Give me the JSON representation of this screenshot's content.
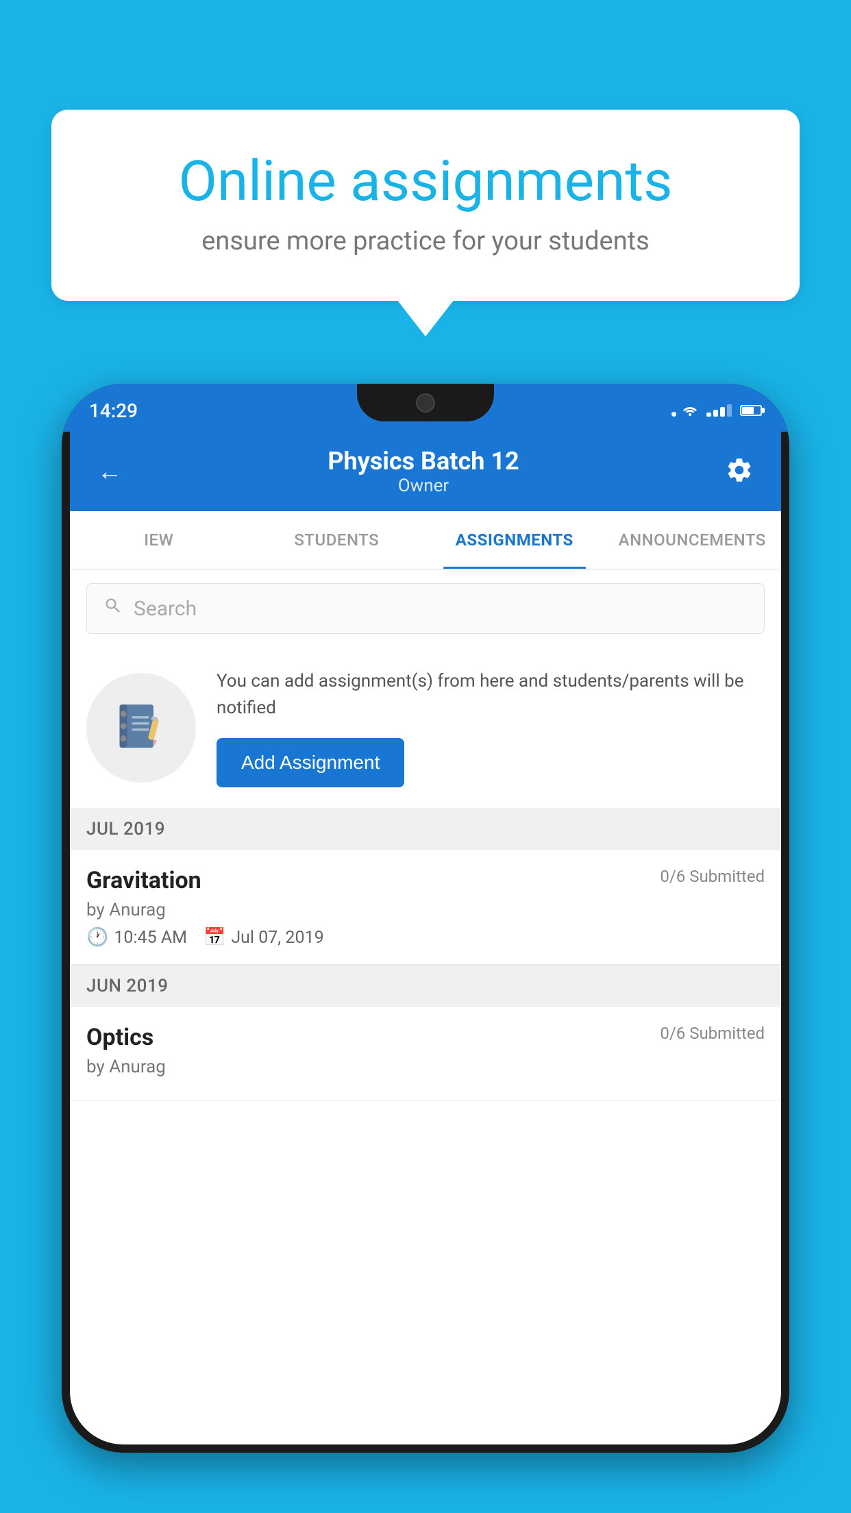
{
  "background_color": "#1ab3e8",
  "speech_bubble": {
    "title": "Online assignments",
    "subtitle": "ensure more practice for your students"
  },
  "phone": {
    "status_bar": {
      "time": "14:29"
    },
    "header": {
      "title": "Physics Batch 12",
      "subtitle": "Owner",
      "back_label": "←",
      "settings_label": "⚙"
    },
    "tabs": [
      {
        "label": "IEW",
        "active": false
      },
      {
        "label": "STUDENTS",
        "active": false
      },
      {
        "label": "ASSIGNMENTS",
        "active": true
      },
      {
        "label": "ANNOUNCEMENTS",
        "active": false
      }
    ],
    "search": {
      "placeholder": "Search"
    },
    "empty_state": {
      "description": "You can add assignment(s) from here and students/parents will be notified",
      "button_label": "Add Assignment"
    },
    "sections": [
      {
        "month": "JUL 2019",
        "assignments": [
          {
            "name": "Gravitation",
            "submitted": "0/6 Submitted",
            "by": "by Anurag",
            "time": "10:45 AM",
            "date": "Jul 07, 2019"
          }
        ]
      },
      {
        "month": "JUN 2019",
        "assignments": [
          {
            "name": "Optics",
            "submitted": "0/6 Submitted",
            "by": "by Anurag",
            "time": "",
            "date": ""
          }
        ]
      }
    ]
  }
}
